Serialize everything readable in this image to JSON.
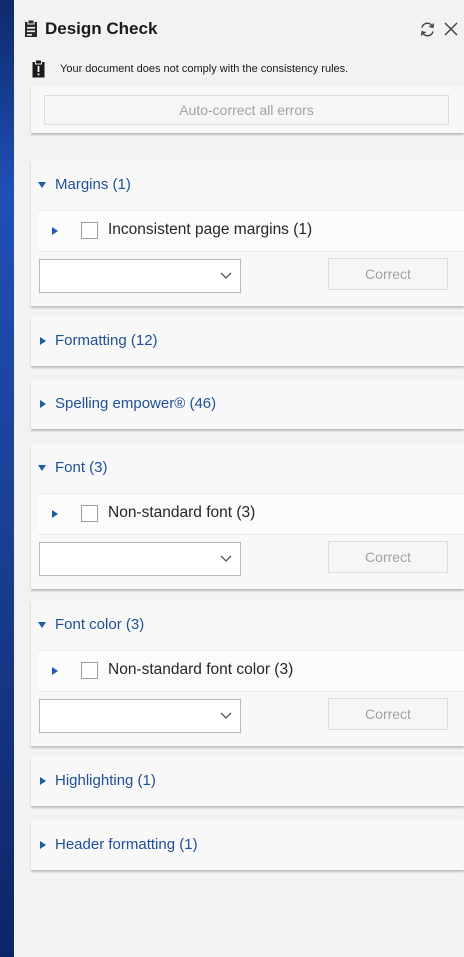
{
  "panel": {
    "title": "Design Check",
    "icons": {
      "title": "clipboard-icon",
      "refresh": "refresh-icon",
      "close": "close-icon",
      "warning": "clipboard-alert-icon"
    }
  },
  "warning": {
    "text": "Your document does not comply with the consistency rules."
  },
  "autocorrect": {
    "label": "Auto-correct all errors"
  },
  "sections": {
    "margins": {
      "title": "Margins (1)",
      "expanded": true,
      "issue": "Inconsistent page margins (1)",
      "select_value": "",
      "correct_label": "Correct"
    },
    "formatting": {
      "title": "Formatting (12)",
      "expanded": false
    },
    "spelling": {
      "title": "Spelling empower® (46)",
      "expanded": false
    },
    "font": {
      "title": "Font (3)",
      "expanded": true,
      "issue": "Non-standard font (3)",
      "select_value": "",
      "correct_label": "Correct"
    },
    "font_color": {
      "title": "Font color (3)",
      "expanded": true,
      "issue": "Non-standard font color (3)",
      "select_value": "",
      "correct_label": "Correct"
    },
    "highlighting": {
      "title": "Highlighting (1)",
      "expanded": false
    },
    "header_formatting": {
      "title": "Header formatting (1)",
      "expanded": false
    }
  },
  "colors": {
    "accent": "#1f4f96",
    "panel_bg": "#f2f2f2",
    "card_bg": "#f8f8f8",
    "disabled_text": "#a3a3a3"
  }
}
